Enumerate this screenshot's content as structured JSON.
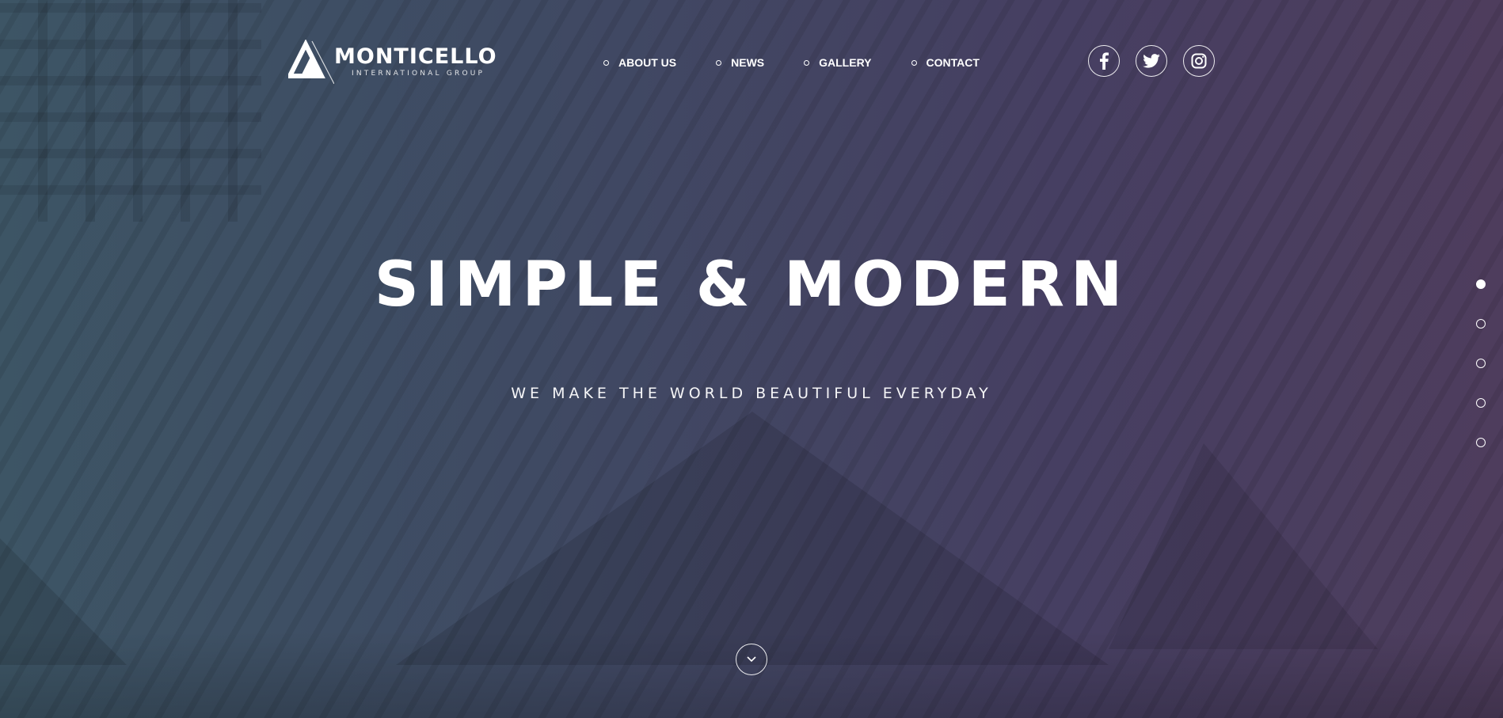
{
  "brand": {
    "name": "MONTICELLO",
    "tagline": "INTERNATIONAL GROUP"
  },
  "nav": {
    "items": [
      {
        "label": "ABOUT US"
      },
      {
        "label": "NEWS"
      },
      {
        "label": "GALLERY"
      },
      {
        "label": "CONTACT"
      }
    ]
  },
  "social": [
    {
      "icon": "facebook-icon"
    },
    {
      "icon": "twitter-icon"
    },
    {
      "icon": "instagram-icon"
    }
  ],
  "hero": {
    "title": "SIMPLE & MODERN",
    "subtitle": "WE MAKE THE WORLD BEAUTIFUL EVERYDAY"
  },
  "pager": {
    "count": 5,
    "active_index": 0
  },
  "scroll_down": {
    "icon": "chevron-down-icon"
  },
  "colors": {
    "gradient_left": "#3d5565",
    "gradient_right": "#4e3d5d",
    "text": "#ffffff"
  }
}
